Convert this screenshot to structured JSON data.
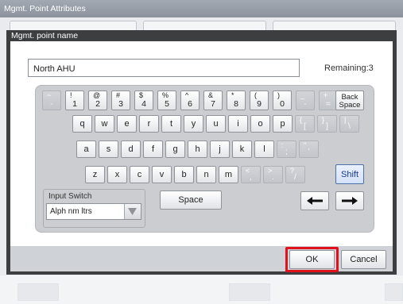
{
  "window": {
    "title": "Mgmt. Point Attributes"
  },
  "dialog": {
    "title": "Mgmt. point name",
    "name_value": "North AHU",
    "remaining_label": "Remaining:3"
  },
  "keyboard": {
    "row1": [
      {
        "main": "-",
        "shift": "~",
        "enabled": false
      },
      {
        "main": "1",
        "shift": "!",
        "enabled": true
      },
      {
        "main": "2",
        "shift": "@",
        "enabled": true
      },
      {
        "main": "3",
        "shift": "#",
        "enabled": true
      },
      {
        "main": "4",
        "shift": "$",
        "enabled": true
      },
      {
        "main": "5",
        "shift": "%",
        "enabled": true
      },
      {
        "main": "6",
        "shift": "^",
        "enabled": true
      },
      {
        "main": "7",
        "shift": "&",
        "enabled": true
      },
      {
        "main": "8",
        "shift": "*",
        "enabled": true
      },
      {
        "main": "9",
        "shift": "(",
        "enabled": true
      },
      {
        "main": "0",
        "shift": ")",
        "enabled": true
      },
      {
        "main": "-",
        "shift": "_",
        "enabled": false
      },
      {
        "main": "=",
        "shift": "+",
        "enabled": false
      }
    ],
    "backspace": {
      "line1": "Back",
      "line2": "Space"
    },
    "row2": [
      {
        "main": "q"
      },
      {
        "main": "w"
      },
      {
        "main": "e"
      },
      {
        "main": "r"
      },
      {
        "main": "t"
      },
      {
        "main": "y"
      },
      {
        "main": "u"
      },
      {
        "main": "i"
      },
      {
        "main": "o"
      },
      {
        "main": "p"
      },
      {
        "main": "[",
        "shift": "{",
        "enabled": false
      },
      {
        "main": "]",
        "shift": "}",
        "enabled": false
      },
      {
        "main": "\\",
        "shift": "|",
        "enabled": false
      }
    ],
    "row3": [
      {
        "main": "a"
      },
      {
        "main": "s"
      },
      {
        "main": "d"
      },
      {
        "main": "f"
      },
      {
        "main": "g"
      },
      {
        "main": "h"
      },
      {
        "main": "j"
      },
      {
        "main": "k"
      },
      {
        "main": "l"
      },
      {
        "main": ";",
        "shift": ":",
        "enabled": false
      },
      {
        "main": "'",
        "shift": "\"",
        "enabled": false
      }
    ],
    "row4": [
      {
        "main": "z"
      },
      {
        "main": "x"
      },
      {
        "main": "c"
      },
      {
        "main": "v"
      },
      {
        "main": "b"
      },
      {
        "main": "n"
      },
      {
        "main": "m"
      },
      {
        "main": ",",
        "shift": "<",
        "enabled": false
      },
      {
        "main": ".",
        "shift": ">",
        "enabled": false
      },
      {
        "main": "/",
        "shift": "?",
        "enabled": false
      }
    ],
    "shift_label": "Shift",
    "space_label": "Space",
    "input_switch_label": "Input Switch",
    "input_switch_value": "Alph nm ltrs"
  },
  "footer": {
    "ok_label": "OK",
    "cancel_label": "Cancel"
  },
  "colors": {
    "highlight": "#e0101c",
    "dialog_frame": "#3d3e40",
    "shift_accent": "#4f6fa8"
  }
}
